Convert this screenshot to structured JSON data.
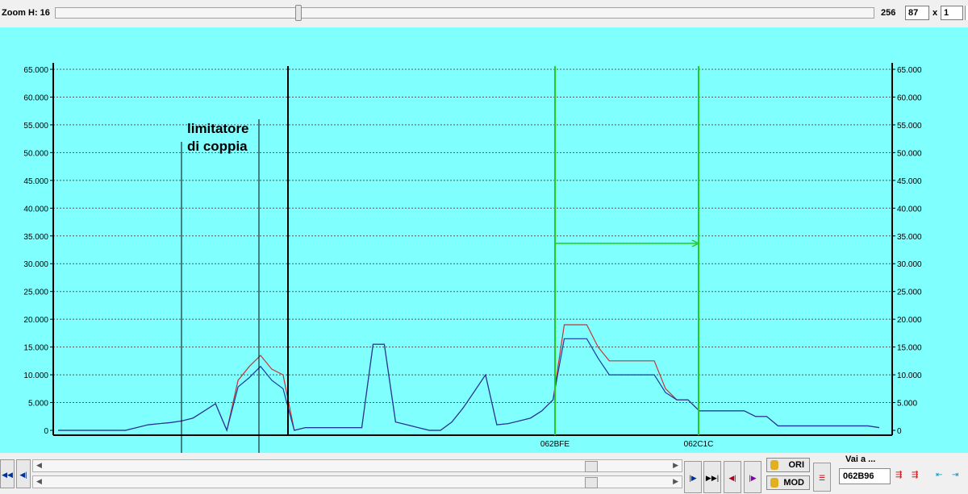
{
  "toolbar": {
    "zoom_label": "Zoom H: 16",
    "zoom_value": "256",
    "box1": "87",
    "times": "x",
    "box2": "1"
  },
  "chart_data": {
    "type": "line",
    "ylim": [
      0,
      65000
    ],
    "yticks": [
      "0",
      "5.000",
      "10.000",
      "15.000",
      "20.000",
      "25.000",
      "30.000",
      "35.000",
      "40.000",
      "45.000",
      "50.000",
      "55.000",
      "60.000",
      "65.000"
    ],
    "grid": true,
    "xlabels": [
      "062BFE",
      "062C1C"
    ],
    "annotation": "limitatore\ndi coppia",
    "series": [
      {
        "color": "#c83232",
        "values": [
          0,
          0,
          0,
          0,
          0,
          0,
          0,
          500,
          1000,
          1200,
          1400,
          1700,
          2200,
          3500,
          4800,
          0,
          9000,
          11500,
          13500,
          11000,
          10000,
          0,
          500,
          500,
          500,
          500,
          500,
          500,
          15500,
          15500,
          1500,
          1000,
          500,
          0,
          0,
          1500,
          4000,
          7000,
          10000,
          1000,
          1200,
          1700,
          2200,
          3500,
          5500,
          19000,
          19000,
          19000,
          15000,
          12500,
          12500,
          12500,
          12500,
          12500,
          7500,
          5500,
          5500,
          3500,
          3500,
          3500,
          3500,
          3500,
          2500,
          2500,
          800,
          800,
          800,
          800,
          800,
          800,
          800,
          800,
          800,
          500
        ]
      },
      {
        "color": "#1a3aa0",
        "values": [
          0,
          0,
          0,
          0,
          0,
          0,
          0,
          500,
          1000,
          1200,
          1400,
          1700,
          2200,
          3500,
          4800,
          0,
          7800,
          9500,
          11500,
          9000,
          7500,
          0,
          500,
          500,
          500,
          500,
          500,
          500,
          15500,
          15500,
          1500,
          1000,
          500,
          0,
          0,
          1500,
          4000,
          7000,
          10000,
          1000,
          1200,
          1700,
          2200,
          3500,
          5500,
          16500,
          16500,
          16500,
          13000,
          10000,
          10000,
          10000,
          10000,
          10000,
          6800,
          5500,
          5500,
          3500,
          3500,
          3500,
          3500,
          3500,
          2500,
          2500,
          800,
          800,
          800,
          800,
          800,
          800,
          800,
          800,
          800,
          500
        ]
      }
    ]
  },
  "bottom": {
    "ori_label": "ORI",
    "mod_label": "MOD",
    "vai_label": "Vai a ...",
    "address": "062B96"
  },
  "colors": {
    "chart_bg": "#80ffff",
    "green_marker": "#22cc22",
    "grid": "#555555"
  }
}
